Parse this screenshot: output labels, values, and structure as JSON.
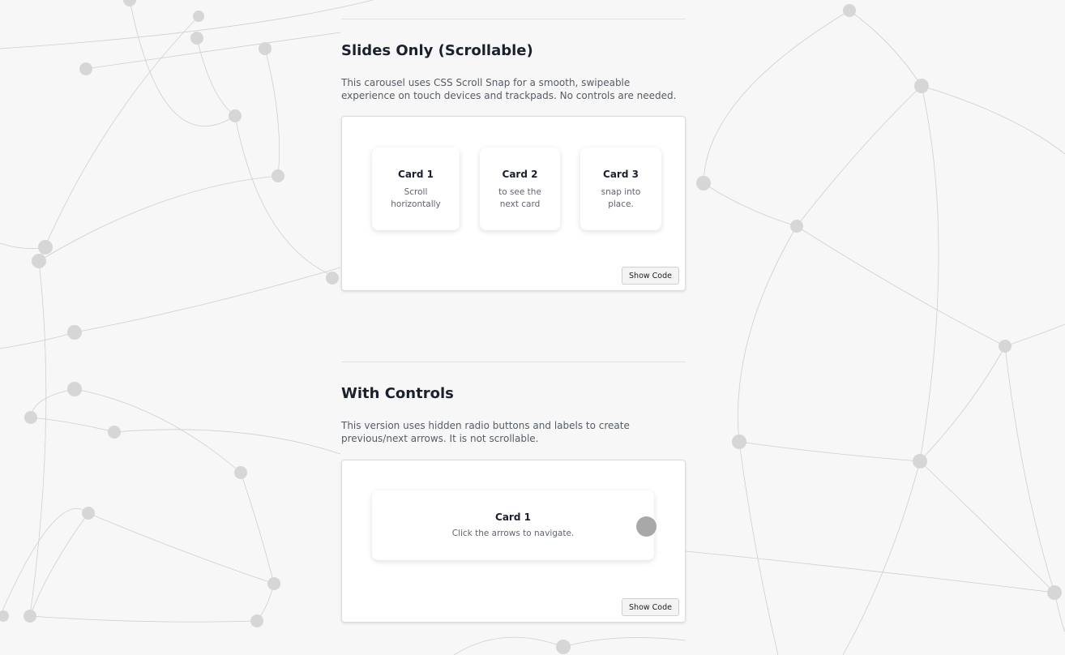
{
  "section1": {
    "title": "Slides Only (Scrollable)",
    "description": "This carousel uses CSS Scroll Snap for a smooth, swipeable experience on touch devices and trackpads. No controls are needed.",
    "cards": [
      {
        "title": "Card 1",
        "text": "Scroll horizontally"
      },
      {
        "title": "Card 2",
        "text": "to see the next card"
      },
      {
        "title": "Card 3",
        "text": "snap into place."
      }
    ],
    "show_code_label": "Show Code"
  },
  "section2": {
    "title": "With Controls",
    "description": "This version uses hidden radio buttons and labels to create previous/next arrows. It is not scrollable.",
    "card": {
      "title": "Card 1",
      "text": "Click the arrows to navigate."
    },
    "show_code_label": "Show Code"
  },
  "colors": {
    "background": "#f7f7f7",
    "panel": "#ffffff",
    "heading": "#1a202c",
    "arrow": "#a8a8a8"
  }
}
